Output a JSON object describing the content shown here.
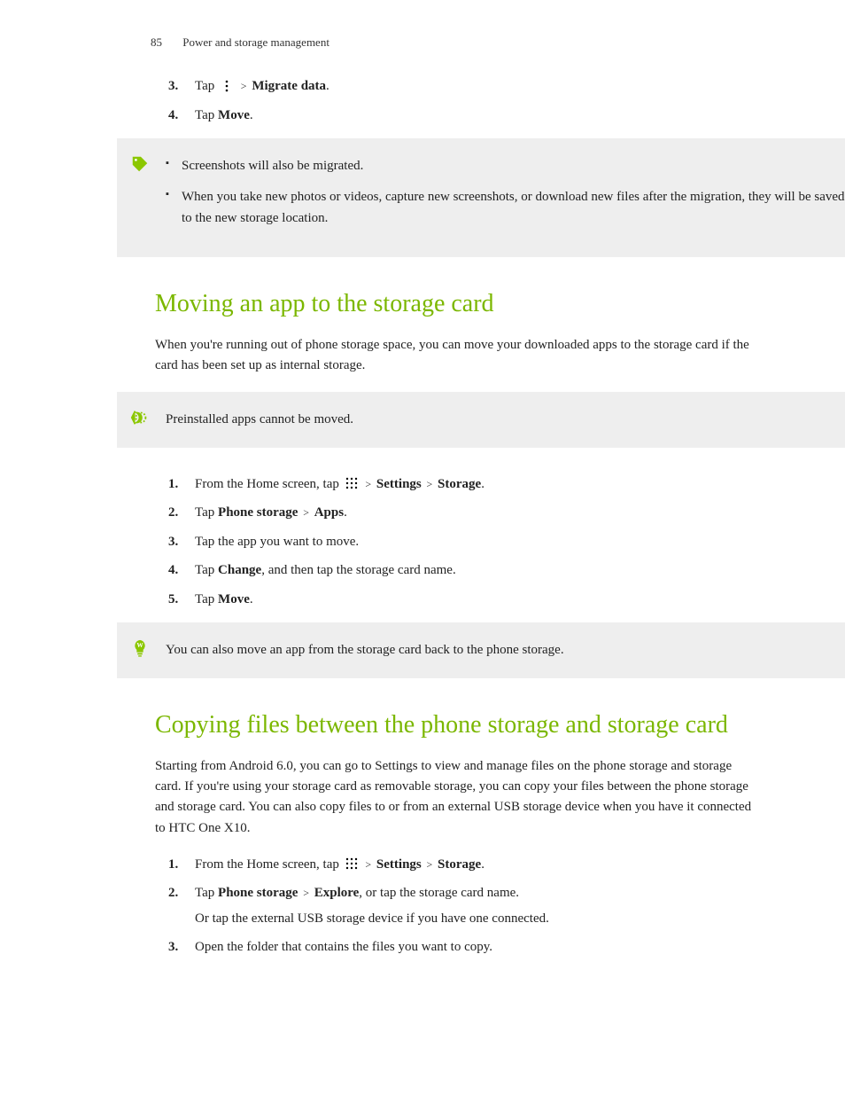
{
  "header": {
    "page_number": "85",
    "section": "Power and storage management"
  },
  "intro_steps": {
    "s3_pre": "Tap ",
    "s3_post": "Migrate data",
    "s3_end": ".",
    "s4_pre": "Tap ",
    "s4_bold": "Move",
    "s4_end": "."
  },
  "note1": {
    "b1": "Screenshots will also be migrated.",
    "b2": "When you take new photos or videos, capture new screenshots, or download new files after the migration, they will be saved to the new storage location."
  },
  "section1": {
    "title": "Moving an app to the storage card",
    "intro": "When you're running out of phone storage space, you can move your downloaded apps to the storage card if the card has been set up as internal storage.",
    "warn": "Preinstalled apps cannot be moved.",
    "s1_pre": "From the Home screen, tap ",
    "s1_b1": "Settings",
    "s1_b2": "Storage",
    "s2_pre": "Tap ",
    "s2_b1": "Phone storage",
    "s2_b2": "Apps",
    "s3": "Tap the app you want to move.",
    "s4_pre": "Tap ",
    "s4_b": "Change",
    "s4_post": ", and then tap the storage card name.",
    "s5_pre": "Tap ",
    "s5_b": "Move",
    "s5_end": ".",
    "tip": "You can also move an app from the storage card back to the phone storage."
  },
  "section2": {
    "title": "Copying files between the phone storage and storage card",
    "intro": "Starting from Android 6.0, you can go to Settings to view and manage files on the phone storage and storage card. If you're using your storage card as removable storage, you can copy your files between the phone storage and storage card. You can also copy files to or from an external USB storage device when you have it connected to HTC One X10.",
    "s1_pre": "From the Home screen, tap ",
    "s1_b1": "Settings",
    "s1_b2": "Storage",
    "s2_pre": "Tap ",
    "s2_b1": "Phone storage",
    "s2_b2": "Explore",
    "s2_post": ", or tap the storage card name.",
    "s2_sub": "Or tap the external USB storage device if you have one connected.",
    "s3": "Open the folder that contains the files you want to copy."
  },
  "gt": ">",
  "dot": "."
}
